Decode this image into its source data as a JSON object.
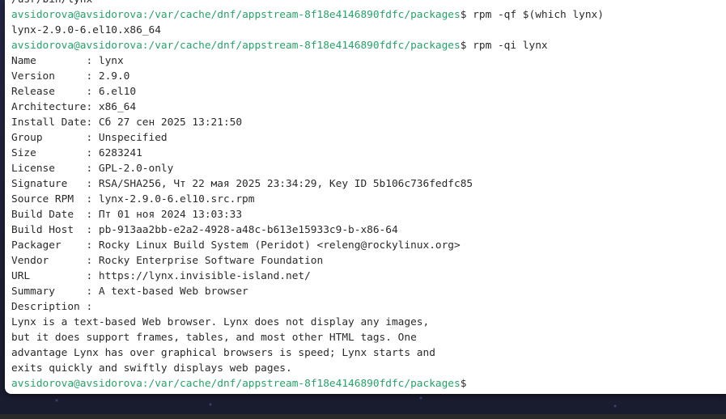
{
  "prompt": {
    "user_host": "avsidorova@avsidorova",
    "path": ":/var/cache/dnf/appstream-8f18e4146890fdfc/packages",
    "symbol": "$"
  },
  "lines": [
    {
      "type": "text",
      "text": "/usr/bin/lynx"
    },
    {
      "type": "prompt",
      "command": " rpm -qf $(which lynx)"
    },
    {
      "type": "text",
      "text": "lynx-2.9.0-6.el10.x86_64"
    },
    {
      "type": "prompt",
      "command": " rpm -qi lynx"
    },
    {
      "type": "text",
      "text": "Name        : lynx"
    },
    {
      "type": "text",
      "text": "Version     : 2.9.0"
    },
    {
      "type": "text",
      "text": "Release     : 6.el10"
    },
    {
      "type": "text",
      "text": "Architecture: x86_64"
    },
    {
      "type": "text",
      "text": "Install Date: Сб 27 сен 2025 13:21:50"
    },
    {
      "type": "text",
      "text": "Group       : Unspecified"
    },
    {
      "type": "text",
      "text": "Size        : 6283241"
    },
    {
      "type": "text",
      "text": "License     : GPL-2.0-only"
    },
    {
      "type": "text",
      "text": "Signature   : RSA/SHA256, Чт 22 мая 2025 23:34:29, Key ID 5b106c736fedfc85"
    },
    {
      "type": "text",
      "text": "Source RPM  : lynx-2.9.0-6.el10.src.rpm"
    },
    {
      "type": "text",
      "text": "Build Date  : Пт 01 ноя 2024 13:03:33"
    },
    {
      "type": "text",
      "text": "Build Host  : pb-913aa2bb-e2a2-4928-a48c-b613e15933c9-b-x86-64"
    },
    {
      "type": "text",
      "text": "Packager    : Rocky Linux Build System (Peridot) <releng@rockylinux.org>"
    },
    {
      "type": "text",
      "text": "Vendor      : Rocky Enterprise Software Foundation"
    },
    {
      "type": "text",
      "text": "URL         : https://lynx.invisible-island.net/"
    },
    {
      "type": "text",
      "text": "Summary     : A text-based Web browser"
    },
    {
      "type": "text",
      "text": "Description :"
    },
    {
      "type": "text",
      "text": "Lynx is a text-based Web browser. Lynx does not display any images,"
    },
    {
      "type": "text",
      "text": "but it does support frames, tables, and most other HTML tags. One"
    },
    {
      "type": "text",
      "text": "advantage Lynx has over graphical browsers is speed; Lynx starts and"
    },
    {
      "type": "text",
      "text": "exits quickly and swiftly displays web pages."
    },
    {
      "type": "prompt",
      "command": ""
    }
  ]
}
